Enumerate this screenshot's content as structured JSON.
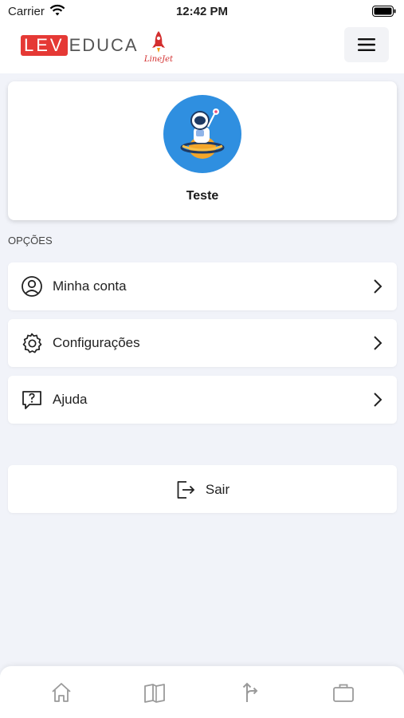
{
  "status_bar": {
    "carrier": "Carrier",
    "time": "12:42 PM"
  },
  "header": {
    "logo_left_highlight": "LEV",
    "logo_left_rest": "EDUCA",
    "logo_right_text": "LineJet",
    "menu_icon": "hamburger-menu-icon"
  },
  "profile": {
    "name": "Teste",
    "avatar_icon": "astronaut-avatar"
  },
  "options": {
    "section_label": "OPÇÕES",
    "items": [
      {
        "label": "Minha conta",
        "icon": "user-circle-icon"
      },
      {
        "label": "Configurações",
        "icon": "gear-icon"
      },
      {
        "label": "Ajuda",
        "icon": "help-bubble-icon"
      }
    ]
  },
  "logout": {
    "label": "Sair",
    "icon": "logout-icon"
  },
  "tab_bar": {
    "tabs": [
      {
        "icon": "home-icon"
      },
      {
        "icon": "book-icon"
      },
      {
        "icon": "route-icon"
      },
      {
        "icon": "briefcase-icon"
      }
    ]
  },
  "colors": {
    "brand_red": "#e53935",
    "avatar_blue": "#2f8fe0",
    "background": "#f1f3f9"
  }
}
